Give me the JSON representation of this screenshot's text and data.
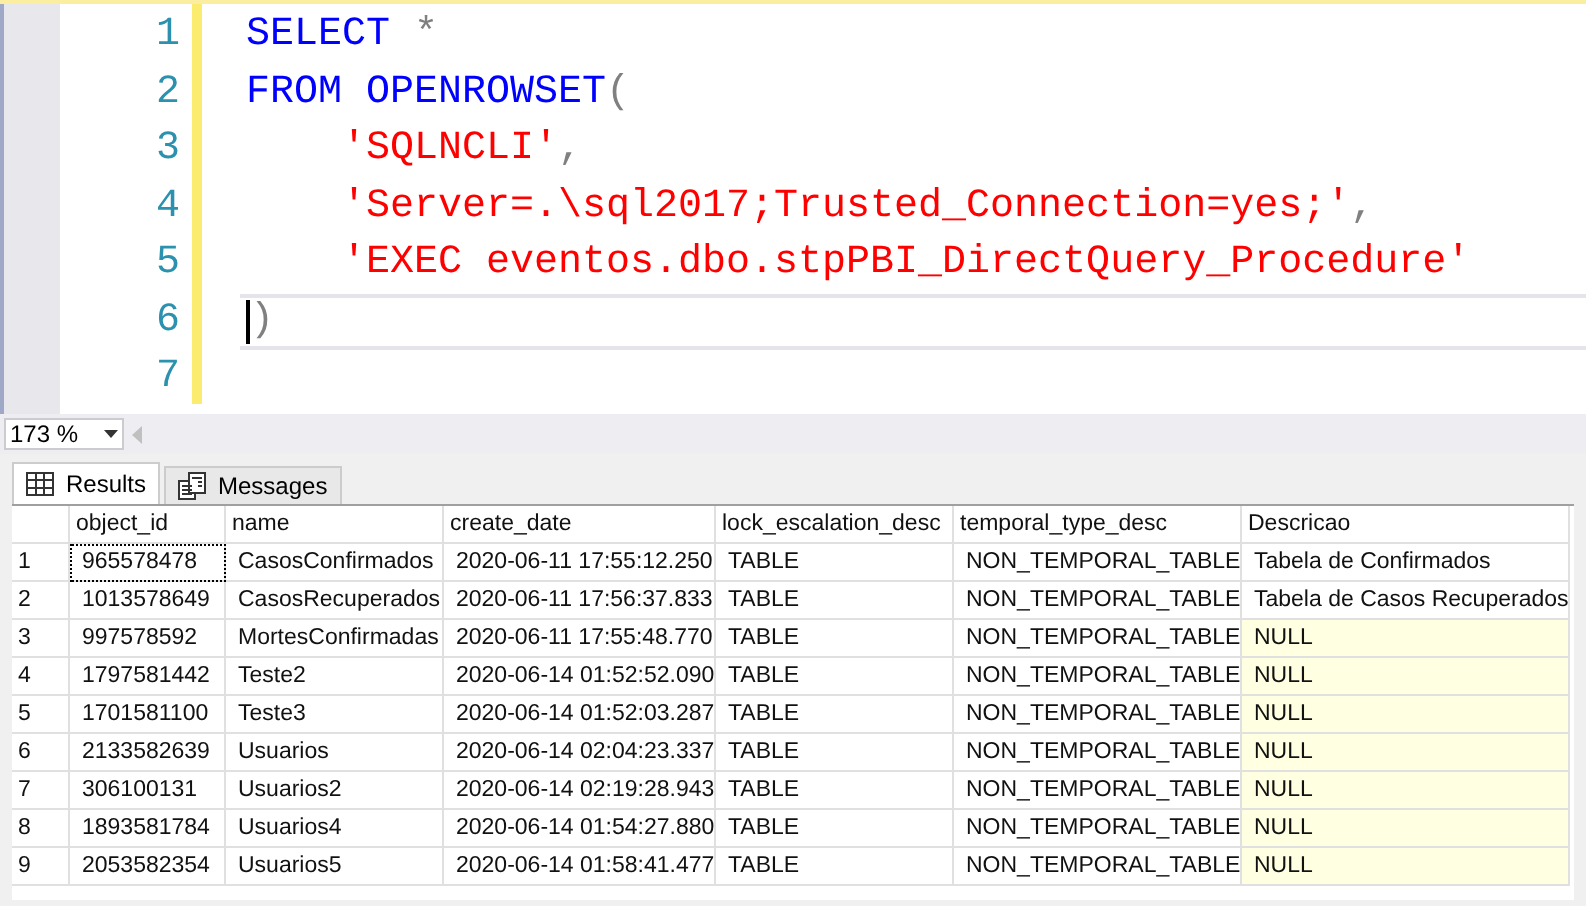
{
  "editor": {
    "lines": [
      {
        "number": "1",
        "current": false,
        "indented": false,
        "tokens": [
          {
            "kind": "keyword",
            "text": "SELECT"
          },
          {
            "kind": "punct",
            "text": " *"
          }
        ]
      },
      {
        "number": "2",
        "current": false,
        "indented": false,
        "tokens": [
          {
            "kind": "keyword",
            "text": "FROM OPENROWSET"
          },
          {
            "kind": "punct",
            "text": "("
          }
        ]
      },
      {
        "number": "3",
        "current": false,
        "indented": true,
        "tokens": [
          {
            "kind": "string",
            "text": "'SQLNCLI'"
          },
          {
            "kind": "punct",
            "text": ","
          }
        ]
      },
      {
        "number": "4",
        "current": false,
        "indented": true,
        "tokens": [
          {
            "kind": "string",
            "text": "'Server=.\\sql2017;Trusted_Connection=yes;'"
          },
          {
            "kind": "punct",
            "text": ","
          }
        ]
      },
      {
        "number": "5",
        "current": false,
        "indented": true,
        "tokens": [
          {
            "kind": "string",
            "text": "'EXEC eventos.dbo.stpPBI_DirectQuery_Procedure'"
          }
        ]
      },
      {
        "number": "6",
        "current": true,
        "indented": false,
        "tokens": [
          {
            "kind": "punct",
            "text": ")"
          }
        ]
      },
      {
        "number": "7",
        "current": false
      }
    ]
  },
  "zoom": {
    "value": "173 %"
  },
  "tabs": [
    {
      "label": "Results",
      "selected": true
    },
    {
      "label": "Messages",
      "selected": false
    }
  ],
  "grid": {
    "columns": [
      "object_id",
      "name",
      "create_date",
      "lock_escalation_desc",
      "temporal_type_desc",
      "Descricao"
    ],
    "rows": [
      {
        "number": "1",
        "focused": true,
        "null_description": false,
        "cells": [
          "965578478",
          "CasosConfirmados",
          "2020-06-11 17:55:12.250",
          "TABLE",
          "NON_TEMPORAL_TABLE",
          "Tabela de Confirmados"
        ]
      },
      {
        "number": "2",
        "focused": false,
        "null_description": false,
        "cells": [
          "1013578649",
          "CasosRecuperados",
          "2020-06-11 17:56:37.833",
          "TABLE",
          "NON_TEMPORAL_TABLE",
          "Tabela de Casos Recuperados"
        ]
      },
      {
        "number": "3",
        "focused": false,
        "null_description": true,
        "cells": [
          "997578592",
          "MortesConfirmadas",
          "2020-06-11 17:55:48.770",
          "TABLE",
          "NON_TEMPORAL_TABLE",
          "NULL"
        ]
      },
      {
        "number": "4",
        "focused": false,
        "null_description": true,
        "cells": [
          "1797581442",
          "Teste2",
          "2020-06-14 01:52:52.090",
          "TABLE",
          "NON_TEMPORAL_TABLE",
          "NULL"
        ]
      },
      {
        "number": "5",
        "focused": false,
        "null_description": true,
        "cells": [
          "1701581100",
          "Teste3",
          "2020-06-14 01:52:03.287",
          "TABLE",
          "NON_TEMPORAL_TABLE",
          "NULL"
        ]
      },
      {
        "number": "6",
        "focused": false,
        "null_description": true,
        "cells": [
          "2133582639",
          "Usuarios",
          "2020-06-14 02:04:23.337",
          "TABLE",
          "NON_TEMPORAL_TABLE",
          "NULL"
        ]
      },
      {
        "number": "7",
        "focused": false,
        "null_description": true,
        "cells": [
          "306100131",
          "Usuarios2",
          "2020-06-14 02:19:28.943",
          "TABLE",
          "NON_TEMPORAL_TABLE",
          "NULL"
        ]
      },
      {
        "number": "8",
        "focused": false,
        "null_description": true,
        "cells": [
          "1893581784",
          "Usuarios4",
          "2020-06-14 01:54:27.880",
          "TABLE",
          "NON_TEMPORAL_TABLE",
          "NULL"
        ]
      },
      {
        "number": "9",
        "focused": false,
        "null_description": true,
        "cells": [
          "2053582354",
          "Usuarios5",
          "2020-06-14 01:58:41.477",
          "TABLE",
          "NON_TEMPORAL_TABLE",
          "NULL"
        ]
      }
    ]
  }
}
